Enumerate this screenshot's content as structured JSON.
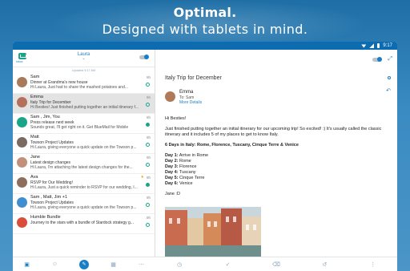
{
  "hero": {
    "title": "Optimal.",
    "subtitle": "Designed with tablets in mind."
  },
  "statusbar": {
    "time": "9:17"
  },
  "sidebar": {
    "account": "Laura",
    "inbox_label": "Inbox",
    "updated": "Updated 9:17 AM"
  },
  "messages": [
    {
      "sender": "Sam",
      "subject": "Dinner at Grandma's new house",
      "snippet": "Hi Laura, Just had to share the mashed potatoes and...",
      "time": "9h"
    },
    {
      "sender": "Emma",
      "subject": "Italy Trip for December",
      "snippet": "Hi Besties! Just finished putting together an initial itinerary f...",
      "time": "9h"
    },
    {
      "sender": "Sam , Jim, You",
      "subject": "Press release next week",
      "snippet": "Sounds great, I'll get right on it. Get BlueMail for Mobile",
      "time": "9h"
    },
    {
      "sender": "Matt",
      "subject": "Towson Project Updates",
      "snippet": "Hi Laura, giving everyone a quick update on the Towson p...",
      "time": "9h"
    },
    {
      "sender": "Jane",
      "subject": "Latest design changes",
      "snippet": "Hi Laura, I'm attaching the latest design changes for the...",
      "time": "9h"
    },
    {
      "sender": "Ava",
      "subject": "RSVP for Our Wedding!",
      "snippet": "Hi Laura, Just a quick reminder to RSVP for our wedding, I...",
      "time": "9h"
    },
    {
      "sender": "Sam , Matt, Jim +1",
      "subject": "Towson Project Updates",
      "snippet": "Hi Laura, giving everyone a quick update on the Towson p...",
      "time": "9h"
    },
    {
      "sender": "Humble Bundle",
      "subject": "Journey to the stars with a bundle of Stardock strategy g...",
      "snippet": "",
      "time": "9h"
    }
  ],
  "email": {
    "title": "Italy Trip for December",
    "from": "Emma",
    "to": "To: Sam",
    "more": "More Details",
    "greeting": "Hi Besties!",
    "intro": "Just finished putting together an initial itinerary for our upcoming trip! So excited! :) It's usually called the classic itinerary and it includes 5 of my places to get to know Italy.",
    "heading": "6 Days in Italy: Rome, Florence, Tuscany, Cinque Terre & Venice",
    "days": [
      {
        "day": "Day 1:",
        "place": "Arrive in Rome"
      },
      {
        "day": "Day 2:",
        "place": "Rome"
      },
      {
        "day": "Day 3:",
        "place": "Florence"
      },
      {
        "day": "Day 4:",
        "place": "Tuscany"
      },
      {
        "day": "Day 5:",
        "place": "Cinque Terre"
      },
      {
        "day": "Day 6:",
        "place": "Venice"
      }
    ],
    "signature": "Jane :D"
  },
  "colors": {
    "accent": "#1a7ec4",
    "statusbar": "#0d6bb0",
    "unread": "#1aa589"
  }
}
